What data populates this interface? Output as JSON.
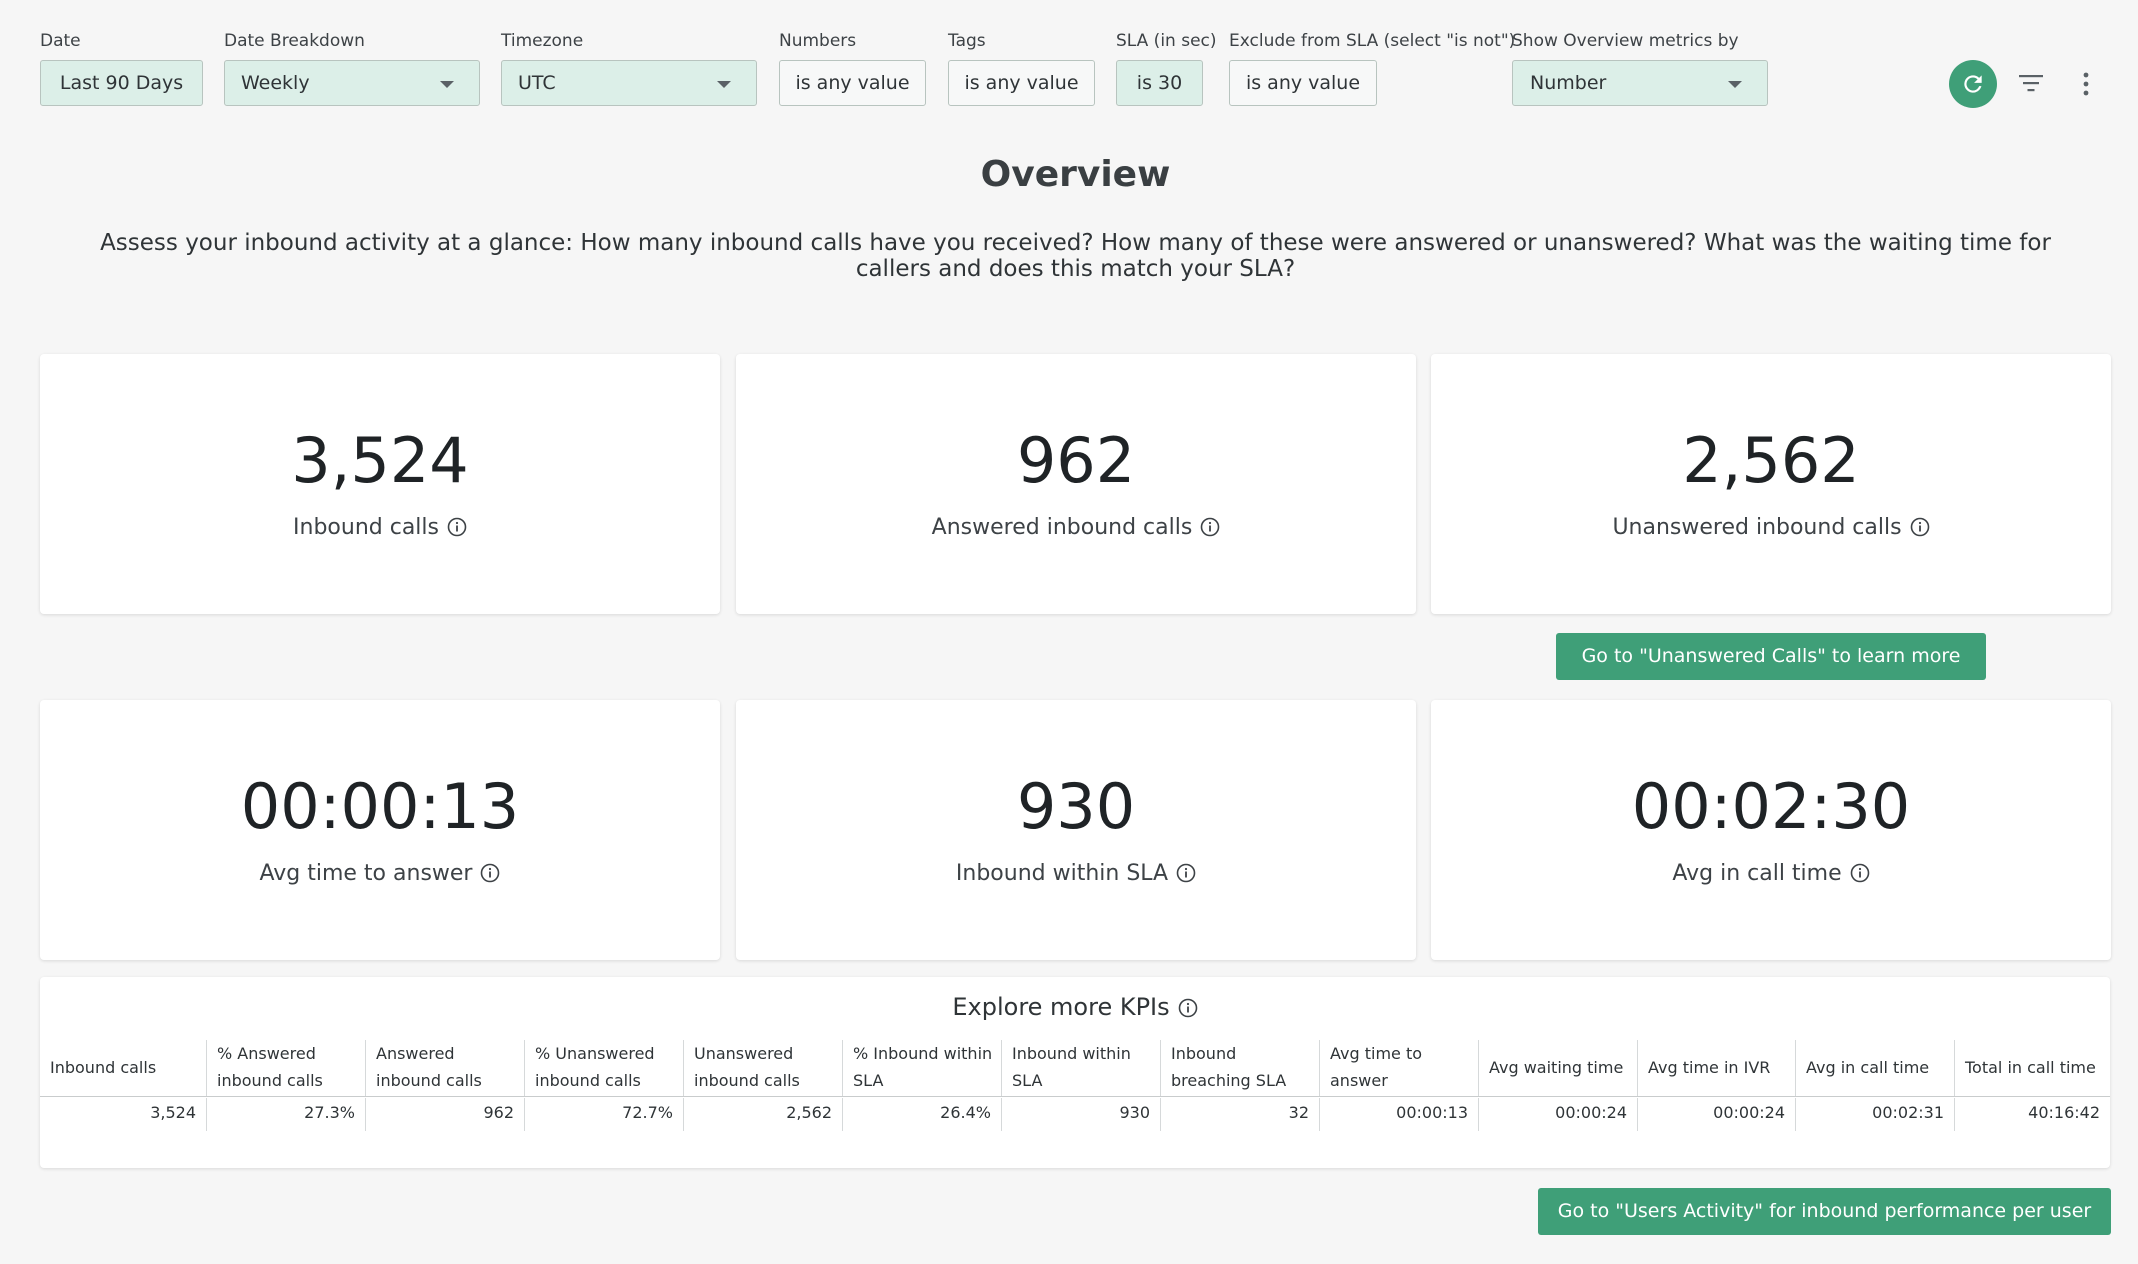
{
  "filters": [
    {
      "label": "Date",
      "value": "Last 90 Days"
    },
    {
      "label": "Date Breakdown",
      "value": "Weekly"
    },
    {
      "label": "Timezone",
      "value": "UTC"
    },
    {
      "label": "Numbers",
      "value": "is any value"
    },
    {
      "label": "Tags",
      "value": "is any value"
    },
    {
      "label": "SLA (in sec)",
      "value": "is 30"
    },
    {
      "label": "Exclude from SLA (select \"is not\")",
      "value": "is any value"
    },
    {
      "label": "Show Overview metrics by",
      "value": "Number"
    }
  ],
  "toolbar_icons": [
    "refresh-icon",
    "filter-icon",
    "more-vert-icon"
  ],
  "colors": {
    "accent": "#3f9f78",
    "filter_active_bg": "#dcefe8",
    "page_bg": "#f6f6f6"
  },
  "overview": {
    "title": "Overview",
    "description": "Assess your inbound activity at a glance: How many inbound calls have you received? How many of these were answered or unanswered? What was the waiting time for callers and does this match your SLA?"
  },
  "metrics": [
    {
      "value": "3,524",
      "label": "Inbound calls"
    },
    {
      "value": "962",
      "label": "Answered inbound calls"
    },
    {
      "value": "2,562",
      "label": "Unanswered inbound calls"
    },
    {
      "value": "00:00:13",
      "label": "Avg time to answer"
    },
    {
      "value": "930",
      "label": "Inbound within SLA"
    },
    {
      "value": "00:02:30",
      "label": "Avg in call time"
    }
  ],
  "unanswered_button": "Go to \"Unanswered Calls\" to learn more",
  "kpis": {
    "title": "Explore more KPIs",
    "columns": [
      [
        "Inbound calls"
      ],
      [
        "% Answered",
        "inbound calls"
      ],
      [
        "Answered",
        "inbound calls"
      ],
      [
        "% Unanswered",
        "inbound calls"
      ],
      [
        "Unanswered",
        "inbound calls"
      ],
      [
        "% Inbound within",
        "SLA"
      ],
      [
        "Inbound within",
        "SLA"
      ],
      [
        "Inbound",
        "breaching SLA"
      ],
      [
        "Avg time to",
        "answer"
      ],
      [
        "Avg waiting time"
      ],
      [
        "Avg time in IVR"
      ],
      [
        "Avg in call time"
      ],
      [
        "Total in call time"
      ]
    ],
    "values": [
      "3,524",
      "27.3%",
      "962",
      "72.7%",
      "2,562",
      "26.4%",
      "930",
      "32",
      "00:00:13",
      "00:00:24",
      "00:00:24",
      "00:02:31",
      "40:16:42"
    ]
  },
  "users_button": "Go to \"Users Activity\" for inbound performance per user"
}
